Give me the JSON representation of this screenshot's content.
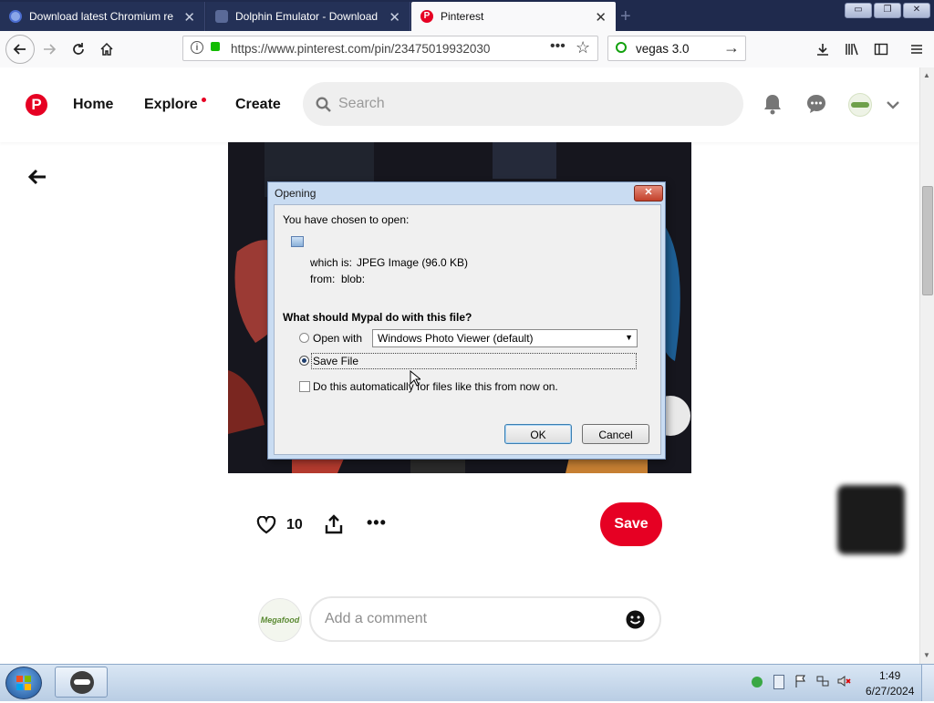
{
  "browser": {
    "tabs": [
      {
        "label": "Download latest Chromium re",
        "active": false
      },
      {
        "label": "Dolphin Emulator - Download",
        "active": false
      },
      {
        "label": "Pinterest",
        "active": true
      }
    ],
    "url": "https://www.pinterest.com/pin/23475019932030",
    "search_value": "vegas 3.0",
    "window_controls": {
      "minimize": "▭",
      "restore": "❐",
      "close": "✕"
    }
  },
  "pinterest": {
    "nav": {
      "home": "Home",
      "explore": "Explore",
      "create": "Create"
    },
    "search_placeholder": "Search",
    "brand_color": "#e60023",
    "likes_count": "10",
    "save_label": "Save",
    "comment_placeholder": "Add a comment",
    "avatar_text": "Megafood"
  },
  "dialog": {
    "title": "Opening",
    "intro": "You have chosen to open:",
    "which_is_label": "which is:",
    "which_is_value": "JPEG Image (96.0 KB)",
    "from_label": "from:",
    "from_value": "blob:",
    "question": "What should Mypal do with this file?",
    "open_with_label": "Open with",
    "open_with_value": "Windows Photo Viewer (default)",
    "save_file_label": "Save File",
    "save_file_selected": true,
    "auto_label": "Do this automatically for files like this from now on.",
    "ok_label": "OK",
    "cancel_label": "Cancel"
  },
  "taskbar": {
    "time": "1:49",
    "date": "6/27/2024"
  }
}
